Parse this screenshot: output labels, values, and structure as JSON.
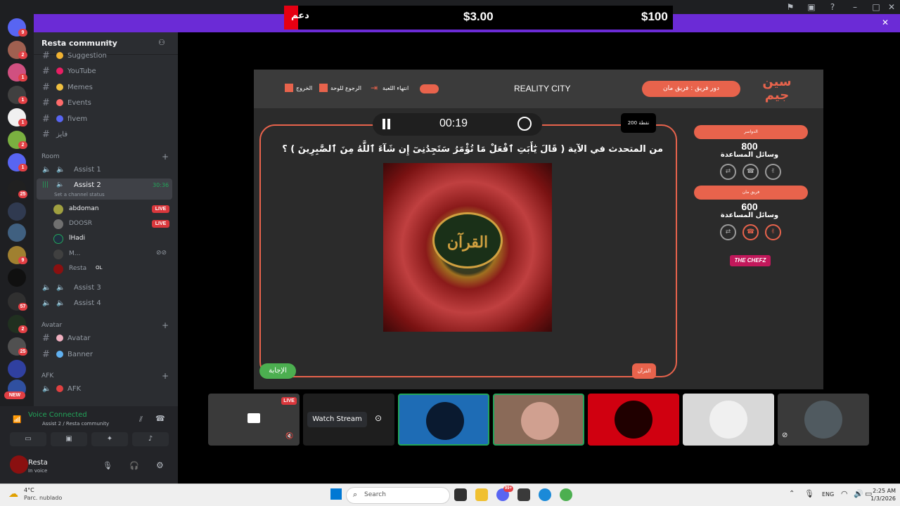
{
  "banner": {
    "donate_label": "دعم",
    "amount_left": "$3.00",
    "amount_right": "$100"
  },
  "rail": {
    "badges": [
      "9",
      "2",
      "1",
      "1",
      "1",
      "2",
      "1",
      "25",
      "9",
      "57",
      "2",
      "25",
      "NEW"
    ]
  },
  "guild": {
    "name": "Resta community"
  },
  "channels": [
    {
      "name": "Suggestion",
      "color": "#f0b232"
    },
    {
      "name": "YouTube",
      "color": "#e91e63"
    },
    {
      "name": "Memes",
      "color": "#f0c040"
    },
    {
      "name": "Events",
      "color": "#ff6b6b"
    },
    {
      "name": "fivem",
      "color": "#5865f2"
    },
    {
      "name": "فايز",
      "color": ""
    }
  ],
  "room": {
    "category": "Room",
    "channels": [
      "Assist 1",
      "Assist 2",
      "Assist 3",
      "Assist 4"
    ],
    "active_timer": "30:36",
    "status_placeholder": "Set a channel status",
    "users": [
      {
        "name": "abdoman",
        "live": "LIVE"
      },
      {
        "name": "DOOSR",
        "live": "LIVE"
      },
      {
        "name": "lHadi",
        "live": ""
      },
      {
        "name": "M...",
        "live": ""
      },
      {
        "name": "Resta",
        "tag": "OL"
      }
    ]
  },
  "avatar_cat": {
    "category": "Avatar",
    "channels": [
      "Avatar",
      "Banner"
    ]
  },
  "afk_cat": {
    "category": "AFK",
    "channels": [
      "AFK"
    ]
  },
  "voice": {
    "title": "Voice Connected",
    "subtitle": "Assist 2 / Resta community"
  },
  "user": {
    "name": "Resta",
    "status": "In voice"
  },
  "game": {
    "title": "REALITY CITY",
    "exit": "الخروج",
    "back": "الرجوع للوحة",
    "end_game": "انتهاء اللعبة",
    "turn": "دور فريق : فريق مان",
    "logo": "سين جيم",
    "timer": "00:19",
    "points": "200 نقطة",
    "question": "من المتحدث في الآية ( قَالَ يَٰٓأَبَتِ ٱفْعَلْ مَا تُؤْمَرُ سَتَجِدُنِىٓ إِن شَآءَ ٱللَّهُ مِنَ ٱلصَّٰبِرِينَ ) ؟",
    "image_text": "القرآن",
    "answer": "الإجابة",
    "category_tag": "القرآن",
    "teams": [
      {
        "name": "الدواسر",
        "score": "800",
        "aids": "وسائل المساعدة"
      },
      {
        "name": "فريق مان",
        "score": "600",
        "aids": "وسائل المساعدة"
      }
    ],
    "sponsor": "THE CHEFZ"
  },
  "tiles": {
    "live": "LIVE",
    "watch": "Watch Stream"
  },
  "taskbar": {
    "weather_temp": "4°C",
    "weather_desc": "Parc. nublado",
    "search": "Search",
    "lang": "ENG",
    "time": "2:25 AM",
    "date": "1/3/2026",
    "discord_badge": "99+"
  }
}
